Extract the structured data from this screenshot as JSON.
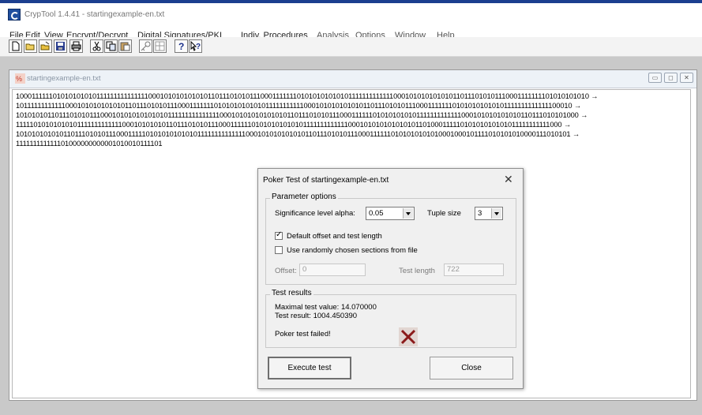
{
  "app": {
    "title": "CrypTool 1.4.41 - startingexample-en.txt"
  },
  "menu": [
    {
      "label": "File"
    },
    {
      "label": "Edit"
    },
    {
      "label": "View"
    },
    {
      "label": "Encrypt/Decrypt"
    },
    {
      "label": "Digital Signatures/PKI"
    },
    {
      "label": "Indiv. Procedures"
    },
    {
      "label": "Analysis"
    },
    {
      "label": "Options"
    },
    {
      "label": "Window"
    },
    {
      "label": "Help"
    }
  ],
  "toolbar": {
    "icons": [
      "new-icon",
      "open-icon",
      "open-folder-icon",
      "save-icon",
      "print-icon",
      "cut-icon",
      "copy-icon",
      "paste-icon",
      "key-icon",
      "document-icon",
      "help-icon",
      "context-help-icon"
    ]
  },
  "document": {
    "title": "startingexample-en.txt",
    "lines": [
      "10001111110101010101011111111111111100010101010101011011101010111000111111101010101010101111111111111000101010101010110111010101110001111111101010101010 →",
      "1011111111111100010101010101011011101010111000111111101010101010101111111111100010101010101011011101010111000111111101010101010101111111111111100010 →",
      "1010101011011101010111000101010101010101111111111111110001010101010101011011101010111000111111010101010101111111111111000101010101010110111010101000 →",
      "1111101010101010111111111111100010101010110111010101110001111110101010101010111111111111100010101010101010110100011111010101010101011111111111000 →",
      "1010101010101101110101011100011111010101010101011111111111111000101010101010110111010101110001111110101010101010001000101111010101010000111010101 →",
      "111111111111101000000000001010010111101"
    ]
  },
  "dialog": {
    "title": "Poker Test of startingexample-en.txt",
    "close_glyph": "✕",
    "parameter_group_label": "Parameter options",
    "alpha_label": "Significance level alpha:",
    "alpha_value": "0.05",
    "tuple_label": "Tuple size",
    "tuple_value": "3",
    "default_offset_label": "Default offset and test length",
    "default_offset_checked": true,
    "random_sections_label": "Use randomly chosen sections from file",
    "random_sections_checked": false,
    "offset_label": "Offset:",
    "offset_value": "0",
    "test_length_label": "Test length",
    "test_length_value": "722",
    "results_group_label": "Test results",
    "max_test_value": "Maximal test value: 14.070000",
    "test_result": "Test result: 1004.450390",
    "status": "Poker test failed!",
    "status_icon": "fail-x-icon",
    "execute_label": "Execute test",
    "close_label": "Close"
  },
  "colors": {
    "fail_x": "#8b1a1a",
    "mdi_background": "#c9c9c9"
  }
}
